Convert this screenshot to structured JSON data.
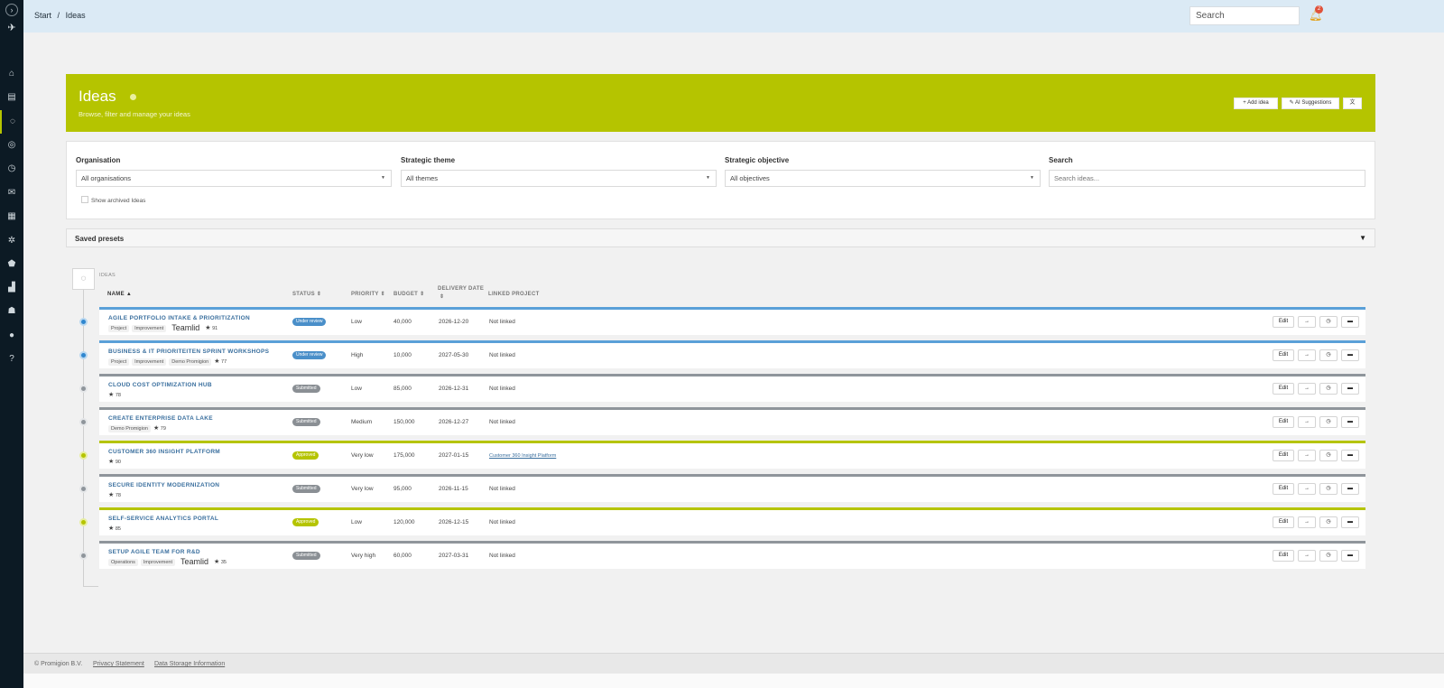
{
  "topbar": {
    "breadcrumb": [
      "Start",
      "/",
      "Ideas"
    ],
    "search_placeholder": "Search",
    "notification_count": "2"
  },
  "sidebar": {
    "toggle_icon": "chevron-right-icon",
    "items": [
      {
        "icon": "home-icon",
        "glyph": "⌂"
      },
      {
        "icon": "inbox-icon",
        "glyph": "▤"
      },
      {
        "icon": "lightbulb-icon",
        "glyph": "◌",
        "active": true
      },
      {
        "icon": "compass-icon",
        "glyph": "◎"
      },
      {
        "icon": "clock-icon",
        "glyph": "◷"
      },
      {
        "icon": "mail-icon",
        "glyph": "✉"
      },
      {
        "icon": "document-icon",
        "glyph": "▦"
      },
      {
        "icon": "gear-icon",
        "glyph": "✲"
      },
      {
        "icon": "shield-icon",
        "glyph": "⬟"
      },
      {
        "icon": "chart-icon",
        "glyph": "▟"
      },
      {
        "icon": "users-icon",
        "glyph": "☗"
      },
      {
        "icon": "user-icon",
        "glyph": "●"
      },
      {
        "icon": "help-icon",
        "glyph": "?"
      }
    ]
  },
  "hero": {
    "title": "Ideas",
    "subtitle": "Browse, filter and manage your ideas",
    "add_label": "+ Add idea",
    "ai_label": "✎ AI Suggestions",
    "translate_icon": "translate-icon",
    "translate_glyph": "文"
  },
  "filters": {
    "organisation": {
      "label": "Organisation",
      "value": "All organisations"
    },
    "theme": {
      "label": "Strategic theme",
      "value": "All themes"
    },
    "objective": {
      "label": "Strategic objective",
      "value": "All objectives"
    },
    "search": {
      "label": "Search",
      "placeholder": "Search ideas..."
    },
    "archived_label": "Show archived Ideas"
  },
  "presets": {
    "label": "Saved presets",
    "caret": "▼"
  },
  "table": {
    "section_label": "IDEAS",
    "headers": {
      "name": "NAME ▲",
      "status": "STATUS ⇕",
      "priority": "PRIORITY ⇕",
      "budget": "BUDGET ⇕",
      "delivery_line1": "DELIVERY DATE",
      "delivery_line2": "⇕",
      "linked": "LINKED PROJECT"
    },
    "actions": {
      "edit": "Edit",
      "move": "→",
      "history": "◷",
      "archive": "▬"
    },
    "rows": [
      {
        "name": "AGILE PORTFOLIO INTAKE & PRIORITIZATION",
        "state": "review",
        "tags": [
          "Project",
          "Improvement"
        ],
        "big_tag": "Teamlid",
        "score": "91",
        "status": "Under review",
        "priority": "Low",
        "budget": "40,000",
        "delivery": "2026-12-20",
        "linked": "Not linked"
      },
      {
        "name": "BUSINESS & IT PRIORITEITEN SPRINT WORKSHOPS",
        "state": "review",
        "tags": [
          "Project",
          "Improvement",
          "Demo Promigion"
        ],
        "big_tag": "",
        "score": "77",
        "status": "Under review",
        "priority": "High",
        "budget": "10,000",
        "delivery": "2027-05-30",
        "linked": "Not linked"
      },
      {
        "name": "CLOUD COST OPTIMIZATION HUB",
        "state": "sub",
        "tags": [],
        "big_tag": "",
        "score": "78",
        "status": "Submitted",
        "priority": "Low",
        "budget": "85,000",
        "delivery": "2026-12-31",
        "linked": "Not linked"
      },
      {
        "name": "CREATE ENTERPRISE DATA LAKE",
        "state": "sub",
        "tags": [
          "Demo Promigion"
        ],
        "big_tag": "",
        "score": "79",
        "status": "Submitted",
        "priority": "Medium",
        "budget": "150,000",
        "delivery": "2026-12-27",
        "linked": "Not linked"
      },
      {
        "name": "CUSTOMER 360 INSIGHT PLATFORM",
        "state": "app",
        "tags": [],
        "big_tag": "",
        "score": "90",
        "status": "Approved",
        "priority": "Very low",
        "budget": "175,000",
        "delivery": "2027-01-15",
        "linked": "Customer 360 Insight Platform"
      },
      {
        "name": "SECURE IDENTITY MODERNIZATION",
        "state": "sub",
        "tags": [],
        "big_tag": "",
        "score": "78",
        "status": "Submitted",
        "priority": "Very low",
        "budget": "95,000",
        "delivery": "2026-11-15",
        "linked": "Not linked"
      },
      {
        "name": "SELF-SERVICE ANALYTICS PORTAL",
        "state": "app",
        "tags": [],
        "big_tag": "",
        "score": "85",
        "status": "Approved",
        "priority": "Low",
        "budget": "120,000",
        "delivery": "2026-12-15",
        "linked": "Not linked"
      },
      {
        "name": "SETUP AGILE TEAM FOR R&D",
        "state": "sub",
        "tags": [
          "Operations",
          "Improvement"
        ],
        "big_tag": "Teamlid",
        "score": "35",
        "status": "Submitted",
        "priority": "Very high",
        "budget": "60,000",
        "delivery": "2027-03-31",
        "linked": "Not linked"
      }
    ]
  },
  "footer": {
    "copyright": "© Promigion B.V.",
    "privacy": "Privacy Statement",
    "storage": "Data Storage Information"
  },
  "colors": {
    "accent": "#b5c400",
    "sidebar": "#0c1a24",
    "review": "#4a8fc9",
    "submitted": "#8a8f94"
  }
}
